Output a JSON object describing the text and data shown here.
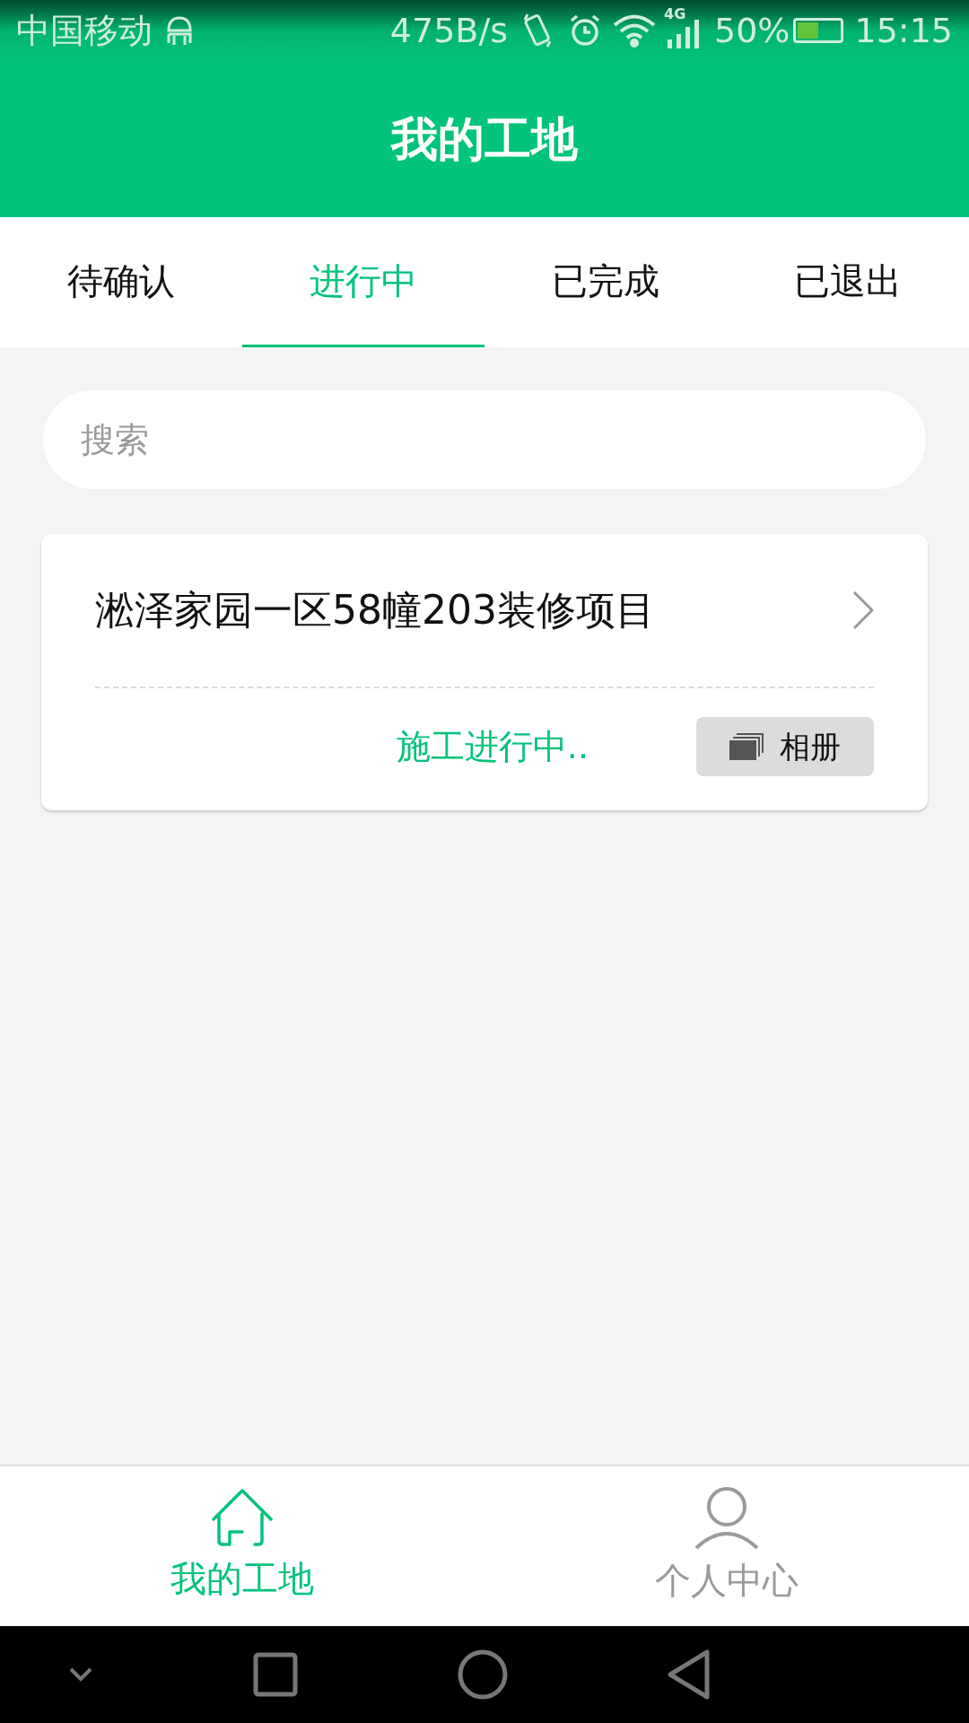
{
  "status_bar": {
    "carrier": "中国移动",
    "network_speed": "475B/s",
    "network_type": "4G",
    "battery": "50%",
    "time": "15:15"
  },
  "header": {
    "title": "我的工地"
  },
  "tabs": [
    {
      "label": "待确认",
      "selected": false
    },
    {
      "label": "进行中",
      "selected": true
    },
    {
      "label": "已完成",
      "selected": false
    },
    {
      "label": "已退出",
      "selected": false
    }
  ],
  "search": {
    "placeholder": "搜索"
  },
  "projects": [
    {
      "title": "淞泽家园一区58幢203装修项目",
      "status": "施工进行中..",
      "album_button": "相册"
    }
  ],
  "bottom_nav": [
    {
      "label": "我的工地",
      "kind": "home",
      "selected": true
    },
    {
      "label": "个人中心",
      "kind": "person",
      "selected": false
    }
  ]
}
